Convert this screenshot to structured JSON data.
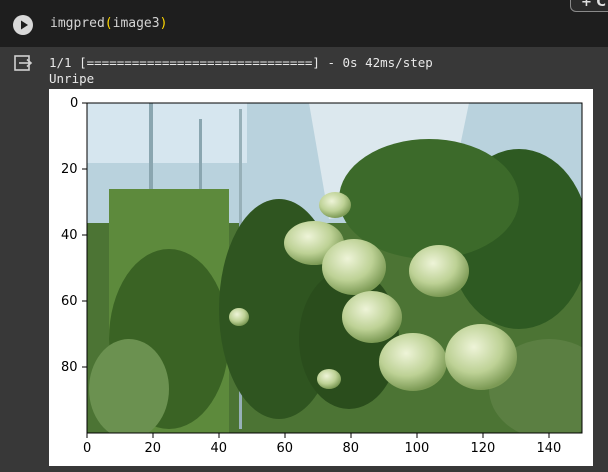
{
  "code_cell": {
    "func": "imgpred",
    "paren_open": "(",
    "arg": "image3",
    "paren_close": ")"
  },
  "floating_button": {
    "label": "+ C"
  },
  "output": {
    "progress_line": "1/1 [==============================] - 0s 42ms/step",
    "prediction": "Unripe"
  },
  "chart_data": {
    "type": "image",
    "image_description_colors": {
      "sky": "#cfe3f2",
      "foliage": "#3f6b2a",
      "tomato": "#c9d9a5"
    },
    "x_ticks": [
      "0",
      "20",
      "40",
      "60",
      "80",
      "100",
      "120",
      "140"
    ],
    "y_ticks": [
      "0",
      "20",
      "40",
      "60",
      "80"
    ],
    "xlim": [
      0,
      150
    ],
    "ylim": [
      0,
      100
    ]
  }
}
